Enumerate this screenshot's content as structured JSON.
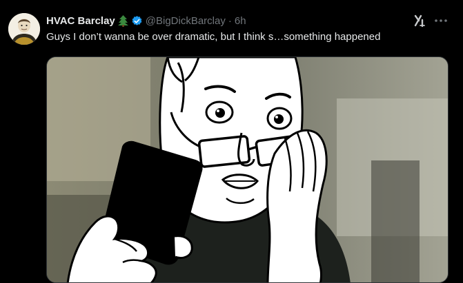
{
  "tweet": {
    "display_name": "HVAC Barclay",
    "name_emoji": "tree-emoji",
    "verified": true,
    "handle": "@BigDickBarclay",
    "separator": "·",
    "time": "6h",
    "text": "Guys I don’t wanna be over dramatic, but I think s…something happened"
  },
  "media": {
    "kind": "meme-illustration",
    "description_icon": "wojak-glasses-phone"
  },
  "colors": {
    "background": "#000000",
    "primary_text": "#e7e9ea",
    "secondary_text": "#71767b",
    "verified_blue": "#1d9bf0",
    "tree_green": "#2e7d32"
  }
}
